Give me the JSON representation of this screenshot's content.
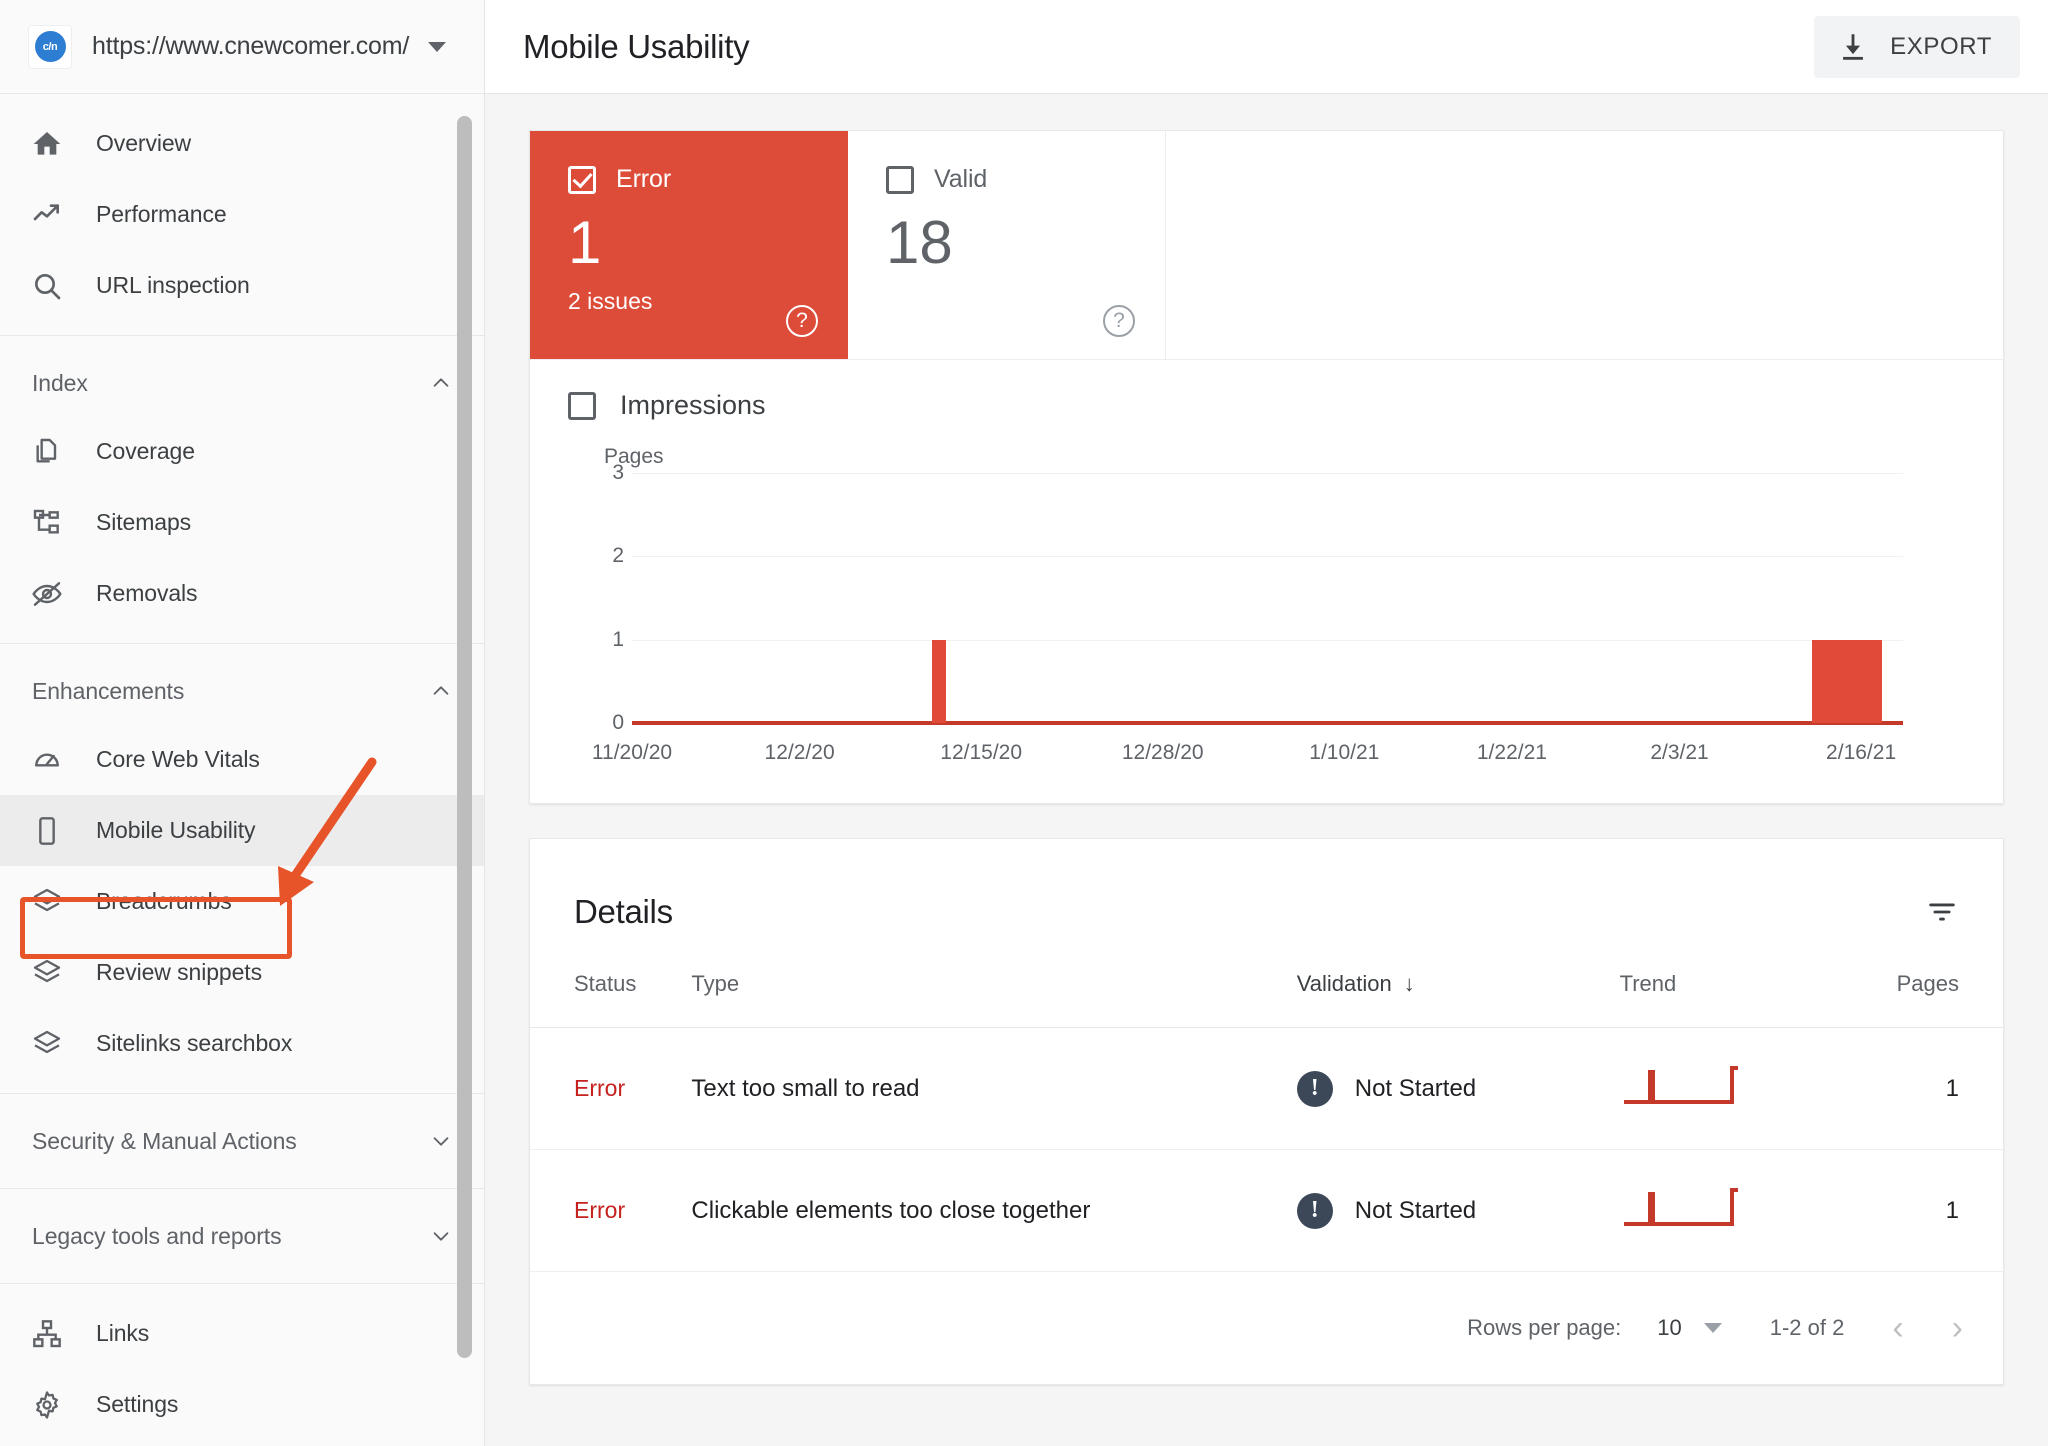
{
  "property": {
    "favicon_label": "c/n",
    "favicon_color": "#2d7dd2",
    "url": "https://www.cnewcomer.com/",
    "dropdown_icon": "chevron-down-icon"
  },
  "sidebar": {
    "groups": [
      {
        "id": "top",
        "items": [
          {
            "icon": "home-icon",
            "label": "Overview"
          },
          {
            "icon": "trending-up-icon",
            "label": "Performance"
          },
          {
            "icon": "search-icon",
            "label": "URL inspection"
          }
        ]
      },
      {
        "id": "index",
        "section_label": "Index",
        "section_state": "expanded",
        "items": [
          {
            "icon": "copy-page-icon",
            "label": "Coverage"
          },
          {
            "icon": "sitemap-icon",
            "label": "Sitemaps"
          },
          {
            "icon": "eye-off-icon",
            "label": "Removals"
          }
        ]
      },
      {
        "id": "enhancements",
        "section_label": "Enhancements",
        "section_state": "expanded",
        "items": [
          {
            "icon": "speedometer-icon",
            "label": "Core Web Vitals"
          },
          {
            "icon": "mobile-phone-icon",
            "label": "Mobile Usability",
            "active": true
          },
          {
            "icon": "layers-icon",
            "label": "Breadcrumbs"
          },
          {
            "icon": "layers-icon",
            "label": "Review snippets"
          },
          {
            "icon": "layers-icon",
            "label": "Sitelinks searchbox"
          }
        ]
      },
      {
        "id": "security",
        "section_label": "Security & Manual Actions",
        "section_state": "collapsed",
        "items": []
      },
      {
        "id": "legacy",
        "section_label": "Legacy tools and reports",
        "section_state": "collapsed",
        "items": []
      },
      {
        "id": "bottom",
        "items": [
          {
            "icon": "links-network-icon",
            "label": "Links"
          },
          {
            "icon": "gear-icon",
            "label": "Settings"
          }
        ]
      }
    ],
    "annotation": {
      "highlight_color": "#e8542a",
      "target": "Mobile Usability"
    }
  },
  "header": {
    "title": "Mobile Usability",
    "export_label": "EXPORT",
    "export_icon": "download-icon"
  },
  "summary": {
    "cards": [
      {
        "id": "error",
        "label": "Error",
        "value": "1",
        "subtext": "2 issues",
        "checked": true,
        "color": "#dd4b39",
        "help_icon": "help-circle-icon"
      },
      {
        "id": "valid",
        "label": "Valid",
        "value": "18",
        "subtext": "",
        "checked": false,
        "color": "#ffffff",
        "help_icon": "help-circle-icon"
      }
    ],
    "impressions": {
      "label": "Impressions",
      "checked": false
    }
  },
  "chart_data": {
    "type": "bar",
    "title": "",
    "ylabel": "Pages",
    "xlabel": "",
    "ylim": [
      0,
      3
    ],
    "yticks": [
      0,
      1,
      2,
      3
    ],
    "grid": true,
    "legend": "none",
    "series_color": "#e04a38",
    "baseline_color": "#c5392a",
    "xtick_labels": [
      "11/20/20",
      "12/2/20",
      "12/15/20",
      "12/28/20",
      "1/10/21",
      "1/22/21",
      "2/3/21",
      "2/16/21"
    ],
    "x_start": "11/20/20",
    "x_end": "2/19/21",
    "points": [
      {
        "x": "12/12/20",
        "y": 1
      },
      {
        "x": "2/13/21",
        "y": 1
      },
      {
        "x": "2/14/21",
        "y": 1
      },
      {
        "x": "2/15/21",
        "y": 1
      },
      {
        "x": "2/16/21",
        "y": 1
      },
      {
        "x": "2/17/21",
        "y": 1
      }
    ],
    "note": "All other days have value 0"
  },
  "details": {
    "title": "Details",
    "filter_icon": "filter-icon",
    "columns": [
      {
        "key": "status",
        "label": "Status",
        "sorted": false
      },
      {
        "key": "type",
        "label": "Type",
        "sorted": false
      },
      {
        "key": "validation",
        "label": "Validation",
        "sorted": true,
        "sort_dir": "↓"
      },
      {
        "key": "trend",
        "label": "Trend",
        "sorted": false
      },
      {
        "key": "pages",
        "label": "Pages",
        "sorted": false
      }
    ],
    "rows": [
      {
        "status": "Error",
        "type": "Text too small to read",
        "validation": "Not Started",
        "validation_icon": "exclamation-icon",
        "pages": "1"
      },
      {
        "status": "Error",
        "type": "Clickable elements too close together",
        "validation": "Not Started",
        "validation_icon": "exclamation-icon",
        "pages": "1"
      }
    ],
    "pagination": {
      "rows_per_page_label": "Rows per page:",
      "rows_per_page_value": "10",
      "range": "1-2 of 2",
      "prev_icon": "chevron-left-icon",
      "next_icon": "chevron-right-icon"
    }
  }
}
